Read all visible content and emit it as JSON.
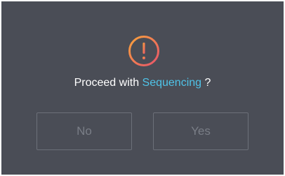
{
  "dialog": {
    "icon": "warning-exclamation-icon",
    "message_prefix": "Proceed with ",
    "message_highlight": "Sequencing",
    "message_suffix": " ?",
    "highlight_color": "#4fc3e8",
    "background_color": "#4a4d56",
    "no_label": "No",
    "yes_label": "Yes"
  }
}
